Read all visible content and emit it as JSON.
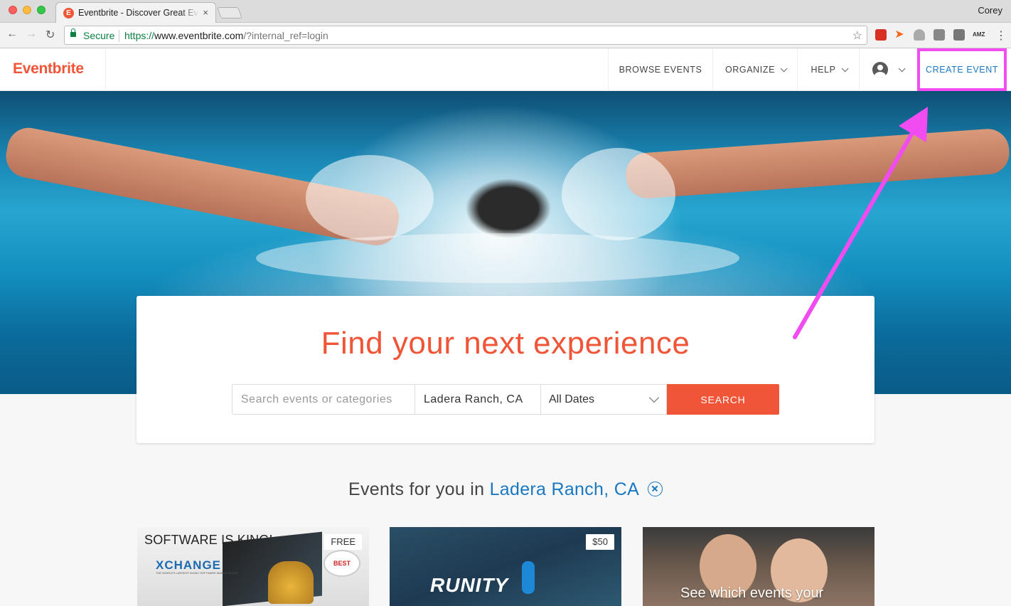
{
  "browser": {
    "tab_title": "Eventbrite - Discover Great Events",
    "tab_favicon_letter": "E",
    "tab_close": "×",
    "profile_name": "Corey",
    "secure_label": "Secure",
    "url_scheme": "https://",
    "url_host": "www.eventbrite.com",
    "url_rest": "/?internal_ref=login",
    "back_glyph": "←",
    "forward_glyph": "→",
    "reload_glyph": "↻",
    "star_glyph": "☆",
    "menu_glyph": "⋮",
    "ext_amz_label": "AMZ"
  },
  "header": {
    "logo": "Eventbrite",
    "nav": {
      "browse": "BROWSE EVENTS",
      "organize": "ORGANIZE",
      "help": "HELP",
      "create": "CREATE EVENT"
    }
  },
  "hero": {
    "headline": "Find your next experience",
    "search_placeholder": "Search events or categories",
    "location_value": "Ladera Ranch, CA",
    "date_value": "All Dates",
    "search_button": "SEARCH"
  },
  "events": {
    "heading_prefix": "Events for you in",
    "location": "Ladera Ranch, CA",
    "cards": [
      {
        "price": "FREE",
        "title": "SOFTWARE IS KING!",
        "brand": "XCHANGE",
        "tagline": "THE WORLD'S LARGEST MUSIC SOFTWARE MARKETPLACE",
        "badge": "BEST"
      },
      {
        "price": "$50",
        "brand": "RUNITY"
      },
      {
        "overlay_text": "See which events your"
      }
    ]
  },
  "colors": {
    "brand_orange": "#f05537",
    "link_blue": "#1a78c2",
    "highlight_magenta": "#f04cf2"
  },
  "icons": {
    "lock": "lock-icon",
    "avatar": "user-avatar-icon",
    "chevron": "chevron-down-icon",
    "clear": "clear-circle-icon"
  }
}
